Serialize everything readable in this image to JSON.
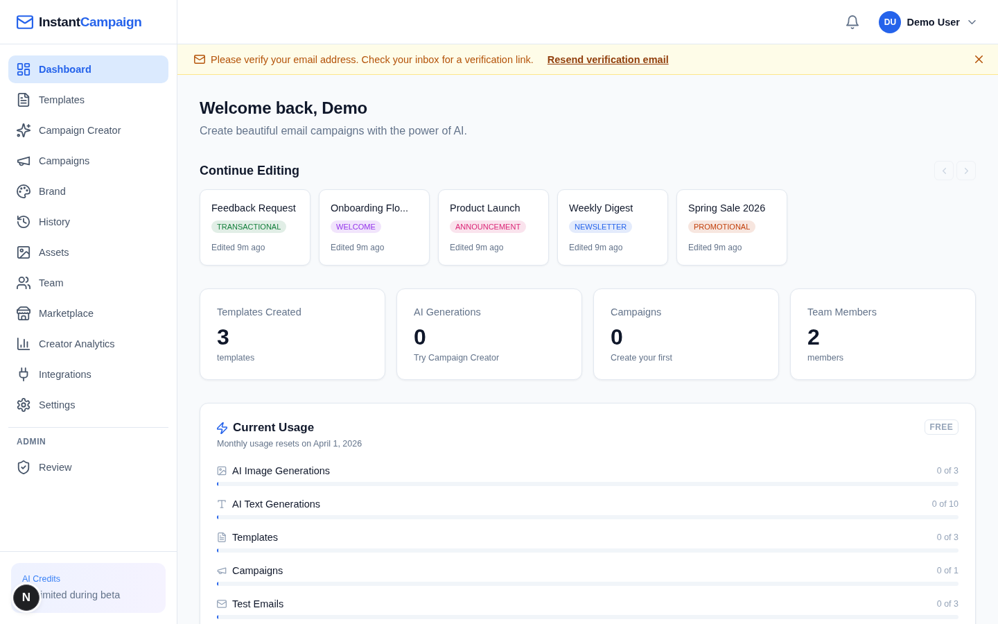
{
  "sidebar": {
    "logo": {
      "prefix": "Instant",
      "accent": "Campaign"
    },
    "items": [
      {
        "label": "Dashboard",
        "selected": true
      },
      {
        "label": "Templates",
        "selected": false
      },
      {
        "label": "Campaign Creator",
        "selected": false
      },
      {
        "label": "Campaigns",
        "selected": false
      },
      {
        "label": "Brand",
        "selected": false
      },
      {
        "label": "History",
        "selected": false
      },
      {
        "label": "Assets",
        "selected": false
      },
      {
        "label": "Team",
        "selected": false
      },
      {
        "label": "Marketplace",
        "selected": false
      },
      {
        "label": "Creator Analytics",
        "selected": false
      },
      {
        "label": "Integrations",
        "selected": false
      },
      {
        "label": "Settings",
        "selected": false
      }
    ],
    "admin_section": {
      "heading": "ADMIN",
      "items": [
        {
          "label": "Review",
          "selected": false
        }
      ]
    },
    "credits_card": {
      "title": "AI Credits",
      "text": "imited during beta"
    }
  },
  "floating_badge": {
    "letter": "N"
  },
  "header": {
    "user": {
      "initials": "DU",
      "name": "Demo User"
    }
  },
  "banner": {
    "message": "Please verify your email address. Check your inbox for a verification link.",
    "link": "Resend verification email"
  },
  "welcome": {
    "title": "Welcome back, Demo",
    "subtitle": "Create beautiful email campaigns with the power of AI."
  },
  "continue_editing": {
    "title": "Continue Editing",
    "nav": [
      {
        "kind": "prev",
        "disabled": true
      },
      {
        "kind": "next",
        "disabled": true
      }
    ],
    "cards": [
      {
        "title": "Feedback Request",
        "tag": "TRANSACTIONAL",
        "color": "#15803d",
        "edited": "Edited 9m ago"
      },
      {
        "title": "Onboarding Flo...",
        "tag": "WELCOME",
        "color": "#9333ea",
        "edited": "Edited 9m ago"
      },
      {
        "title": "Product Launch",
        "tag": "ANNOUNCEMENT",
        "color": "#db2777",
        "edited": "Edited 9m ago"
      },
      {
        "title": "Weekly Digest",
        "tag": "NEWSLETTER",
        "color": "#2563eb",
        "edited": "Edited 9m ago"
      },
      {
        "title": "Spring Sale 2026",
        "tag": "PROMOTIONAL",
        "color": "#c2410c",
        "edited": "Edited 9m ago"
      }
    ]
  },
  "stats": [
    {
      "label": "Templates Created",
      "value": "3",
      "note": "templates"
    },
    {
      "label": "AI Generations",
      "value": "0",
      "note": "Try Campaign Creator"
    },
    {
      "label": "Campaigns",
      "value": "0",
      "note": "Create your first"
    },
    {
      "label": "Team Members",
      "value": "2",
      "note": "members"
    }
  ],
  "usage": {
    "title": "Current Usage",
    "subtitle": "Monthly usage resets on April 1, 2026",
    "plan": "FREE",
    "rows": [
      {
        "label": "AI Image Generations",
        "count": "0 of 3",
        "level": 0
      },
      {
        "label": "AI Text Generations",
        "count": "0 of 10",
        "level": 0
      },
      {
        "label": "Templates",
        "count": "0 of 3",
        "level": 0
      },
      {
        "label": "Campaigns",
        "count": "0 of 1",
        "level": 0
      },
      {
        "label": "Test Emails",
        "count": "0 of 3",
        "level": 0
      }
    ]
  }
}
